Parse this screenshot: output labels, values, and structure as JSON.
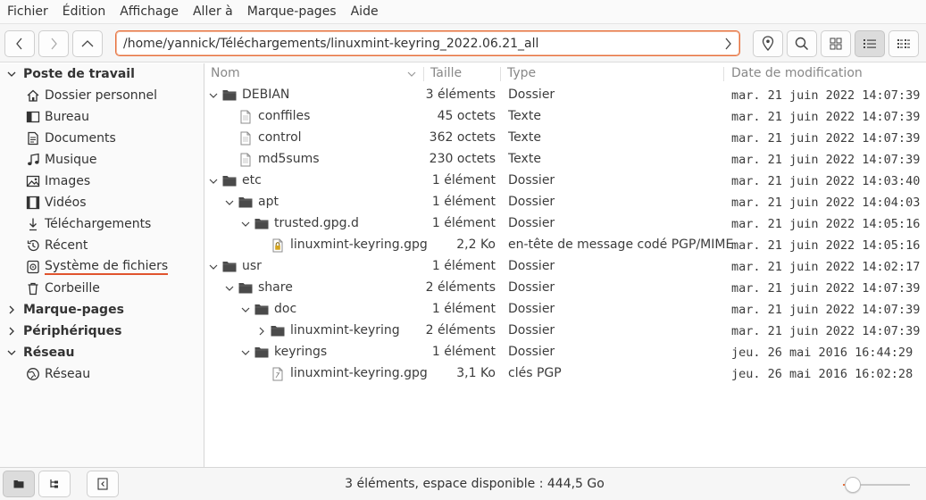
{
  "menu": [
    "Fichier",
    "Édition",
    "Affichage",
    "Aller à",
    "Marque-pages",
    "Aide"
  ],
  "location": {
    "path": "/home/yannick/Téléchargements/linuxmint-keyring_2022.06.21_all"
  },
  "sidebar": {
    "poste": "Poste de travail",
    "items": [
      "Dossier personnel",
      "Bureau",
      "Documents",
      "Musique",
      "Images",
      "Vidéos",
      "Téléchargements",
      "Récent",
      "Système de fichiers",
      "Corbeille"
    ],
    "marque_pages": "Marque-pages",
    "peripheriques": "Périphériques",
    "reseau_section": "Réseau",
    "reseau_item": "Réseau"
  },
  "columns": {
    "name": "Nom",
    "size": "Taille",
    "type": "Type",
    "date": "Date de modification"
  },
  "rows": [
    {
      "name": "DEBIAN",
      "size": "3 éléments",
      "type": "Dossier",
      "date": "mar. 21 juin 2022 14:07:39"
    },
    {
      "name": "conffiles",
      "size": "45 octets",
      "type": "Texte",
      "date": "mar. 21 juin 2022 14:07:39"
    },
    {
      "name": "control",
      "size": "362 octets",
      "type": "Texte",
      "date": "mar. 21 juin 2022 14:07:39"
    },
    {
      "name": "md5sums",
      "size": "230 octets",
      "type": "Texte",
      "date": "mar. 21 juin 2022 14:07:39"
    },
    {
      "name": "etc",
      "size": "1 élément",
      "type": "Dossier",
      "date": "mar. 21 juin 2022 14:03:40"
    },
    {
      "name": "apt",
      "size": "1 élément",
      "type": "Dossier",
      "date": "mar. 21 juin 2022 14:04:03"
    },
    {
      "name": "trusted.gpg.d",
      "size": "1 élément",
      "type": "Dossier",
      "date": "mar. 21 juin 2022 14:05:16"
    },
    {
      "name": "linuxmint-keyring.gpg",
      "size": "2,2 Ko",
      "type": "en-tête de message codé PGP/MIME",
      "date": "mar. 21 juin 2022 14:05:16"
    },
    {
      "name": "usr",
      "size": "1 élément",
      "type": "Dossier",
      "date": "mar. 21 juin 2022 14:02:17"
    },
    {
      "name": "share",
      "size": "2 éléments",
      "type": "Dossier",
      "date": "mar. 21 juin 2022 14:07:39"
    },
    {
      "name": "doc",
      "size": "1 élément",
      "type": "Dossier",
      "date": "mar. 21 juin 2022 14:07:39"
    },
    {
      "name": "linuxmint-keyring",
      "size": "2 éléments",
      "type": "Dossier",
      "date": "mar. 21 juin 2022 14:07:39"
    },
    {
      "name": "keyrings",
      "size": "1 élément",
      "type": "Dossier",
      "date": "jeu. 26 mai 2016 16:44:29"
    },
    {
      "name": "linuxmint-keyring.gpg",
      "size": "3,1 Ko",
      "type": "clés PGP",
      "date": "jeu. 26 mai 2016 16:02:28"
    }
  ],
  "status": "3 éléments, espace disponible : 444,5 Go",
  "zoom": {
    "level": 0.03
  },
  "colors": {
    "accent": "#e8703d",
    "folder": "#4a4a4a"
  }
}
